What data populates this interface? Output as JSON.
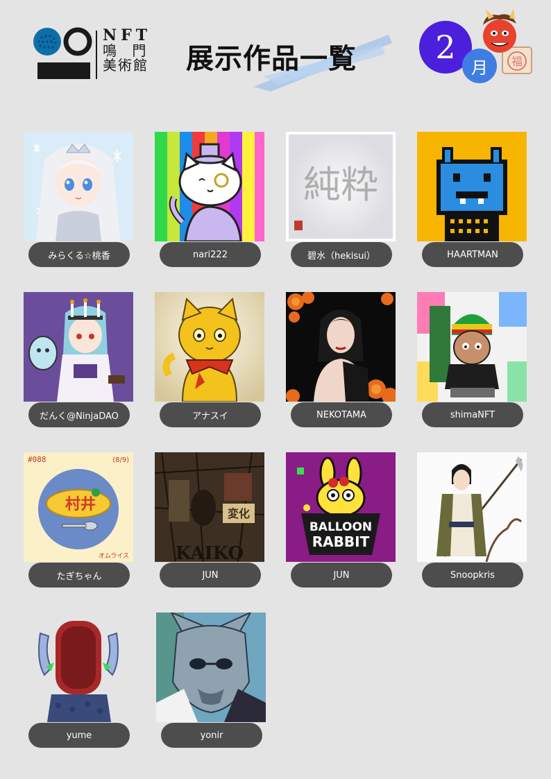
{
  "header": {
    "logo_line1": "NFT",
    "logo_line2": "鳴 門",
    "logo_line3": "美術館",
    "title": "展示作品一覧",
    "month_number": "2",
    "month_unit": "月",
    "fuku_char": "福"
  },
  "artworks": [
    {
      "artist": "みらくる☆桃香"
    },
    {
      "artist": "nari222"
    },
    {
      "artist": "碧水（hekisui）"
    },
    {
      "artist": "HAARTMAN"
    },
    {
      "artist": "だんく@NinjaDAO"
    },
    {
      "artist": "アナスイ"
    },
    {
      "artist": "NEKOTAMA"
    },
    {
      "artist": "shimaNFT"
    },
    {
      "artist": "たぎちゃん"
    },
    {
      "artist": "JUN"
    },
    {
      "artist": "JUN"
    },
    {
      "artist": "Snoopkris"
    },
    {
      "artist": "yume"
    },
    {
      "artist": "yonir"
    }
  ],
  "art_text": {
    "tagi_num": "#088",
    "tagi_date": "(8/9)",
    "tagi_kanji": "村井",
    "tagi_bottom": "オムライス",
    "jun_kanji": "変化",
    "jun_bottom": "KAIKO",
    "balloon_1": "BALLOON",
    "balloon_2": "RABBIT",
    "hekisui_calligraphy": "純粋"
  }
}
